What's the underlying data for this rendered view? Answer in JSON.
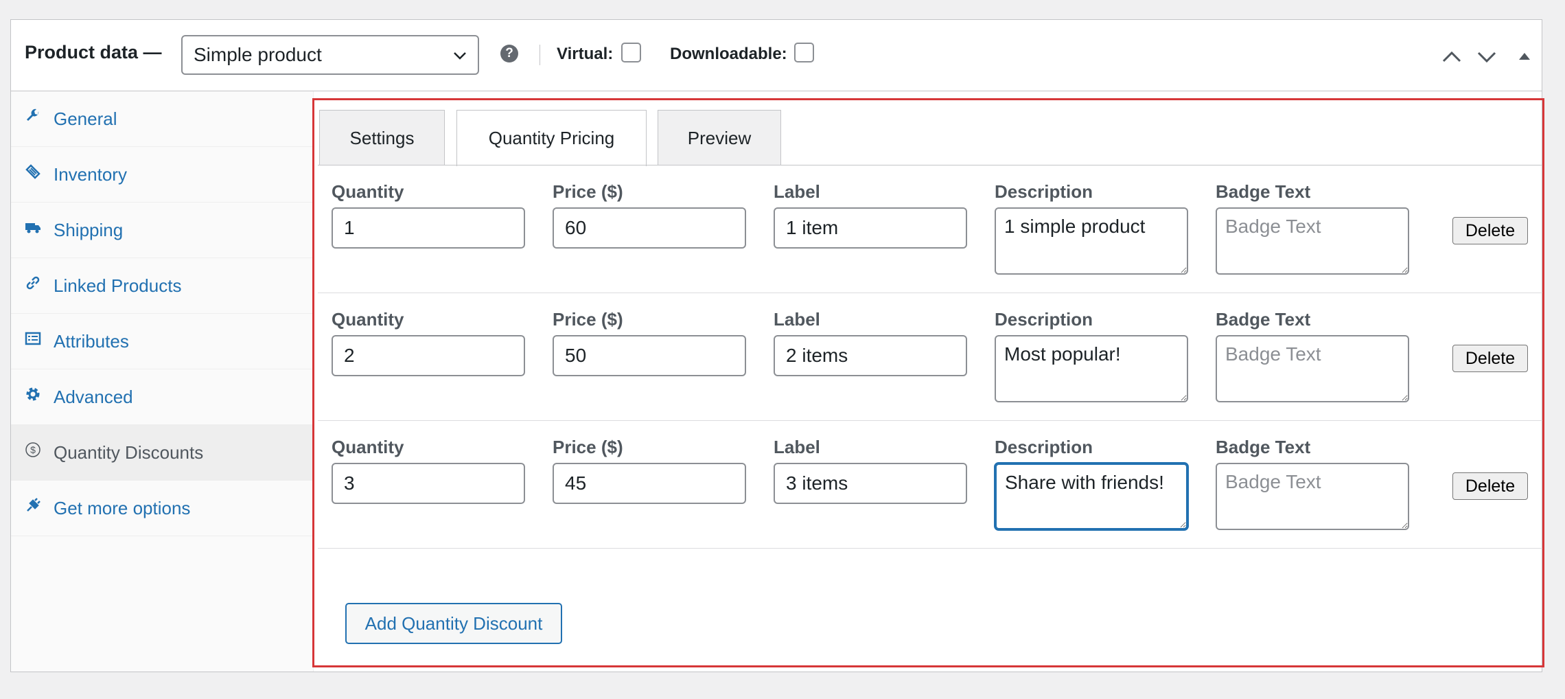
{
  "header": {
    "title": "Product data —",
    "product_type": "Simple product",
    "help": "?",
    "virtual_label": "Virtual:",
    "downloadable_label": "Downloadable:"
  },
  "sidebar": {
    "items": [
      {
        "label": "General",
        "icon": "wrench-icon"
      },
      {
        "label": "Inventory",
        "icon": "tag-icon"
      },
      {
        "label": "Shipping",
        "icon": "truck-icon"
      },
      {
        "label": "Linked Products",
        "icon": "link-icon"
      },
      {
        "label": "Attributes",
        "icon": "list-icon"
      },
      {
        "label": "Advanced",
        "icon": "gear-icon"
      },
      {
        "label": "Quantity Discounts",
        "icon": "dollar-icon"
      },
      {
        "label": "Get more options",
        "icon": "plugin-icon"
      }
    ],
    "active_index": 6
  },
  "subtabs": [
    "Settings",
    "Quantity Pricing",
    "Preview"
  ],
  "active_subtab": "Quantity Pricing",
  "field_labels": {
    "quantity": "Quantity",
    "price": "Price ($)",
    "label": "Label",
    "description": "Description",
    "badge": "Badge Text"
  },
  "badge_placeholder": "Badge Text",
  "rows": [
    {
      "quantity": "1",
      "price": "60",
      "label": "1 item",
      "description": "1 simple product",
      "badge": ""
    },
    {
      "quantity": "2",
      "price": "50",
      "label": "2 items",
      "description": "Most popular!",
      "badge": ""
    },
    {
      "quantity": "3",
      "price": "45",
      "label": "3 items",
      "description": "Share with friends!",
      "badge": ""
    }
  ],
  "delete_label": "Delete",
  "add_label": "Add Quantity Discount",
  "colors": {
    "link": "#2271b1",
    "highlight_border": "#d63638"
  }
}
